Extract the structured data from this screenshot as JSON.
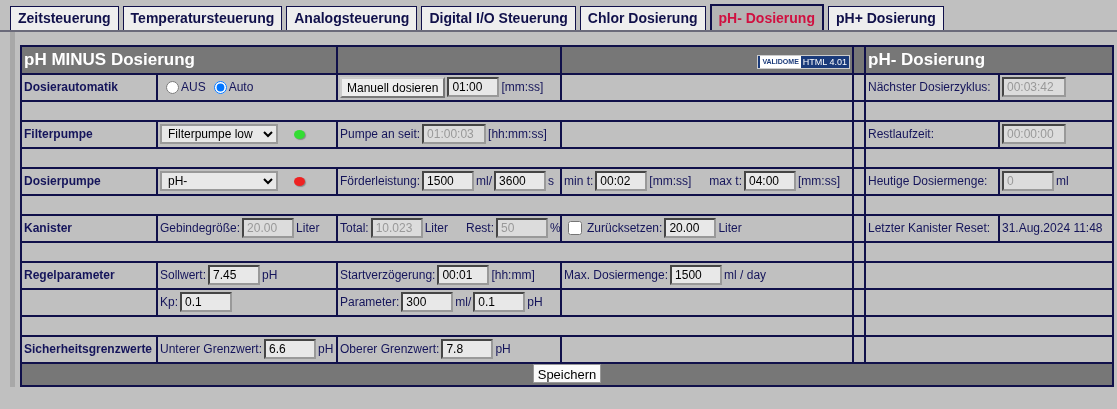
{
  "tabs": [
    {
      "label": "Zeitsteuerung",
      "selected": false
    },
    {
      "label": "Temperatursteuerung",
      "selected": false
    },
    {
      "label": "Analogsteuerung",
      "selected": false
    },
    {
      "label": "Digital I/O Steuerung",
      "selected": false
    },
    {
      "label": "Chlor Dosierung",
      "selected": false
    },
    {
      "label": "pH- Dosierung",
      "selected": true
    },
    {
      "label": "pH+ Dosierung",
      "selected": false
    }
  ],
  "panel": {
    "title": "pH MINUS Dosierung",
    "badge": {
      "logo": "VALIDOME",
      "text": "HTML 4.01"
    },
    "side_title": "pH- Dosierung"
  },
  "sections": [
    {
      "rows": [
        {
          "label": "Dosierautomatik",
          "cells": [
            [
              {
                "kind": "radio",
                "label": "AUS",
                "selected": false
              },
              {
                "kind": "radio",
                "label": "Auto",
                "selected": true
              }
            ],
            [
              {
                "kind": "button",
                "label": "Manuell dosieren"
              },
              {
                "kind": "input",
                "value": "01:00",
                "disabled": false
              },
              {
                "kind": "text",
                "text": "[mm:ss]"
              }
            ],
            []
          ],
          "side": {
            "label": "Nächster Dosierzyklus:",
            "items": [
              {
                "kind": "input",
                "value": "00:03:42",
                "disabled": true
              }
            ]
          }
        }
      ]
    },
    {
      "rows": [
        {
          "label": "Filterpumpe",
          "cells": [
            [
              {
                "kind": "select",
                "value": "Filterpumpe low"
              },
              {
                "kind": "led",
                "color": "#33dd33"
              }
            ],
            [
              {
                "kind": "text",
                "text": "Pumpe an seit:"
              },
              {
                "kind": "input",
                "value": "01:00:03",
                "disabled": true
              },
              {
                "kind": "text",
                "text": "[hh:mm:ss]"
              }
            ],
            []
          ],
          "side": {
            "label": "Restlaufzeit:",
            "items": [
              {
                "kind": "input",
                "value": "00:00:00",
                "disabled": true
              }
            ]
          }
        }
      ]
    },
    {
      "rows": [
        {
          "label": "Dosierpumpe",
          "cells": [
            [
              {
                "kind": "select",
                "value": "pH-"
              },
              {
                "kind": "led",
                "color": "#ee2222"
              }
            ],
            [
              {
                "kind": "text",
                "text": "Förderleistung:"
              },
              {
                "kind": "input",
                "value": "1500",
                "disabled": false
              },
              {
                "kind": "text",
                "text": "ml/"
              },
              {
                "kind": "input",
                "value": "3600",
                "disabled": false
              },
              {
                "kind": "text",
                "text": "s"
              }
            ],
            [
              {
                "kind": "text",
                "text": "min t:"
              },
              {
                "kind": "input",
                "value": "00:02",
                "disabled": false
              },
              {
                "kind": "text",
                "text": "[mm:ss]"
              },
              {
                "kind": "text",
                "text": "max t:"
              },
              {
                "kind": "input",
                "value": "04:00",
                "disabled": false
              },
              {
                "kind": "text",
                "text": "[mm:ss]"
              }
            ]
          ],
          "side": {
            "label": "Heutige Dosiermenge:",
            "items": [
              {
                "kind": "input",
                "value": "0",
                "disabled": true
              },
              {
                "kind": "text",
                "text": "ml"
              }
            ]
          }
        }
      ]
    },
    {
      "rows": [
        {
          "label": "Kanister",
          "cells": [
            [
              {
                "kind": "text",
                "text": "Gebindegröße:"
              },
              {
                "kind": "input",
                "value": "20.00",
                "disabled": true
              },
              {
                "kind": "text",
                "text": "Liter"
              }
            ],
            [
              {
                "kind": "text",
                "text": "Total:"
              },
              {
                "kind": "input",
                "value": "10.023",
                "disabled": true
              },
              {
                "kind": "text",
                "text": "Liter"
              },
              {
                "kind": "text",
                "text": "Rest:"
              },
              {
                "kind": "input",
                "value": "50",
                "disabled": true
              },
              {
                "kind": "text",
                "text": "%"
              }
            ],
            [
              {
                "kind": "checkbox",
                "checked": false
              },
              {
                "kind": "text",
                "text": "Zurücksetzen:"
              },
              {
                "kind": "input",
                "value": "20.00",
                "disabled": false
              },
              {
                "kind": "text",
                "text": "Liter"
              }
            ]
          ],
          "side": {
            "label": "Letzter Kanister Reset:",
            "items": [
              {
                "kind": "text",
                "text": "31.Aug.2024 11:48"
              }
            ]
          }
        }
      ]
    },
    {
      "rows": [
        {
          "label": "Regelparameter",
          "cells": [
            [
              {
                "kind": "text",
                "text": "Sollwert:"
              },
              {
                "kind": "input",
                "value": "7.45",
                "disabled": false
              },
              {
                "kind": "text",
                "text": "pH"
              }
            ],
            [
              {
                "kind": "text",
                "text": "Startverzögerung:"
              },
              {
                "kind": "input",
                "value": "00:01",
                "disabled": false
              },
              {
                "kind": "text",
                "text": "[hh:mm]"
              }
            ],
            [
              {
                "kind": "text",
                "text": "Max. Dosiermenge:"
              },
              {
                "kind": "input",
                "value": "1500",
                "disabled": false
              },
              {
                "kind": "text",
                "text": "ml / day"
              }
            ]
          ]
        },
        {
          "cells": [
            [
              {
                "kind": "text",
                "text": "Kp:"
              },
              {
                "kind": "input",
                "value": "0.1",
                "disabled": false
              }
            ],
            [
              {
                "kind": "text",
                "text": "Parameter:"
              },
              {
                "kind": "input",
                "value": "300",
                "disabled": false
              },
              {
                "kind": "text",
                "text": "ml/"
              },
              {
                "kind": "input",
                "value": "0.1",
                "disabled": false
              },
              {
                "kind": "text",
                "text": "pH"
              }
            ],
            []
          ]
        }
      ]
    },
    {
      "rows": [
        {
          "label": "Sicherheitsgrenzwerte",
          "cells": [
            [
              {
                "kind": "text",
                "text": "Unterer Grenzwert:"
              },
              {
                "kind": "input",
                "value": "6.6",
                "disabled": false
              },
              {
                "kind": "text",
                "text": "pH"
              }
            ],
            [
              {
                "kind": "text",
                "text": "Oberer Grenzwert:"
              },
              {
                "kind": "input",
                "value": "7.8",
                "disabled": false
              },
              {
                "kind": "text",
                "text": "pH"
              }
            ],
            []
          ]
        }
      ]
    }
  ],
  "save_button": "Speichern"
}
